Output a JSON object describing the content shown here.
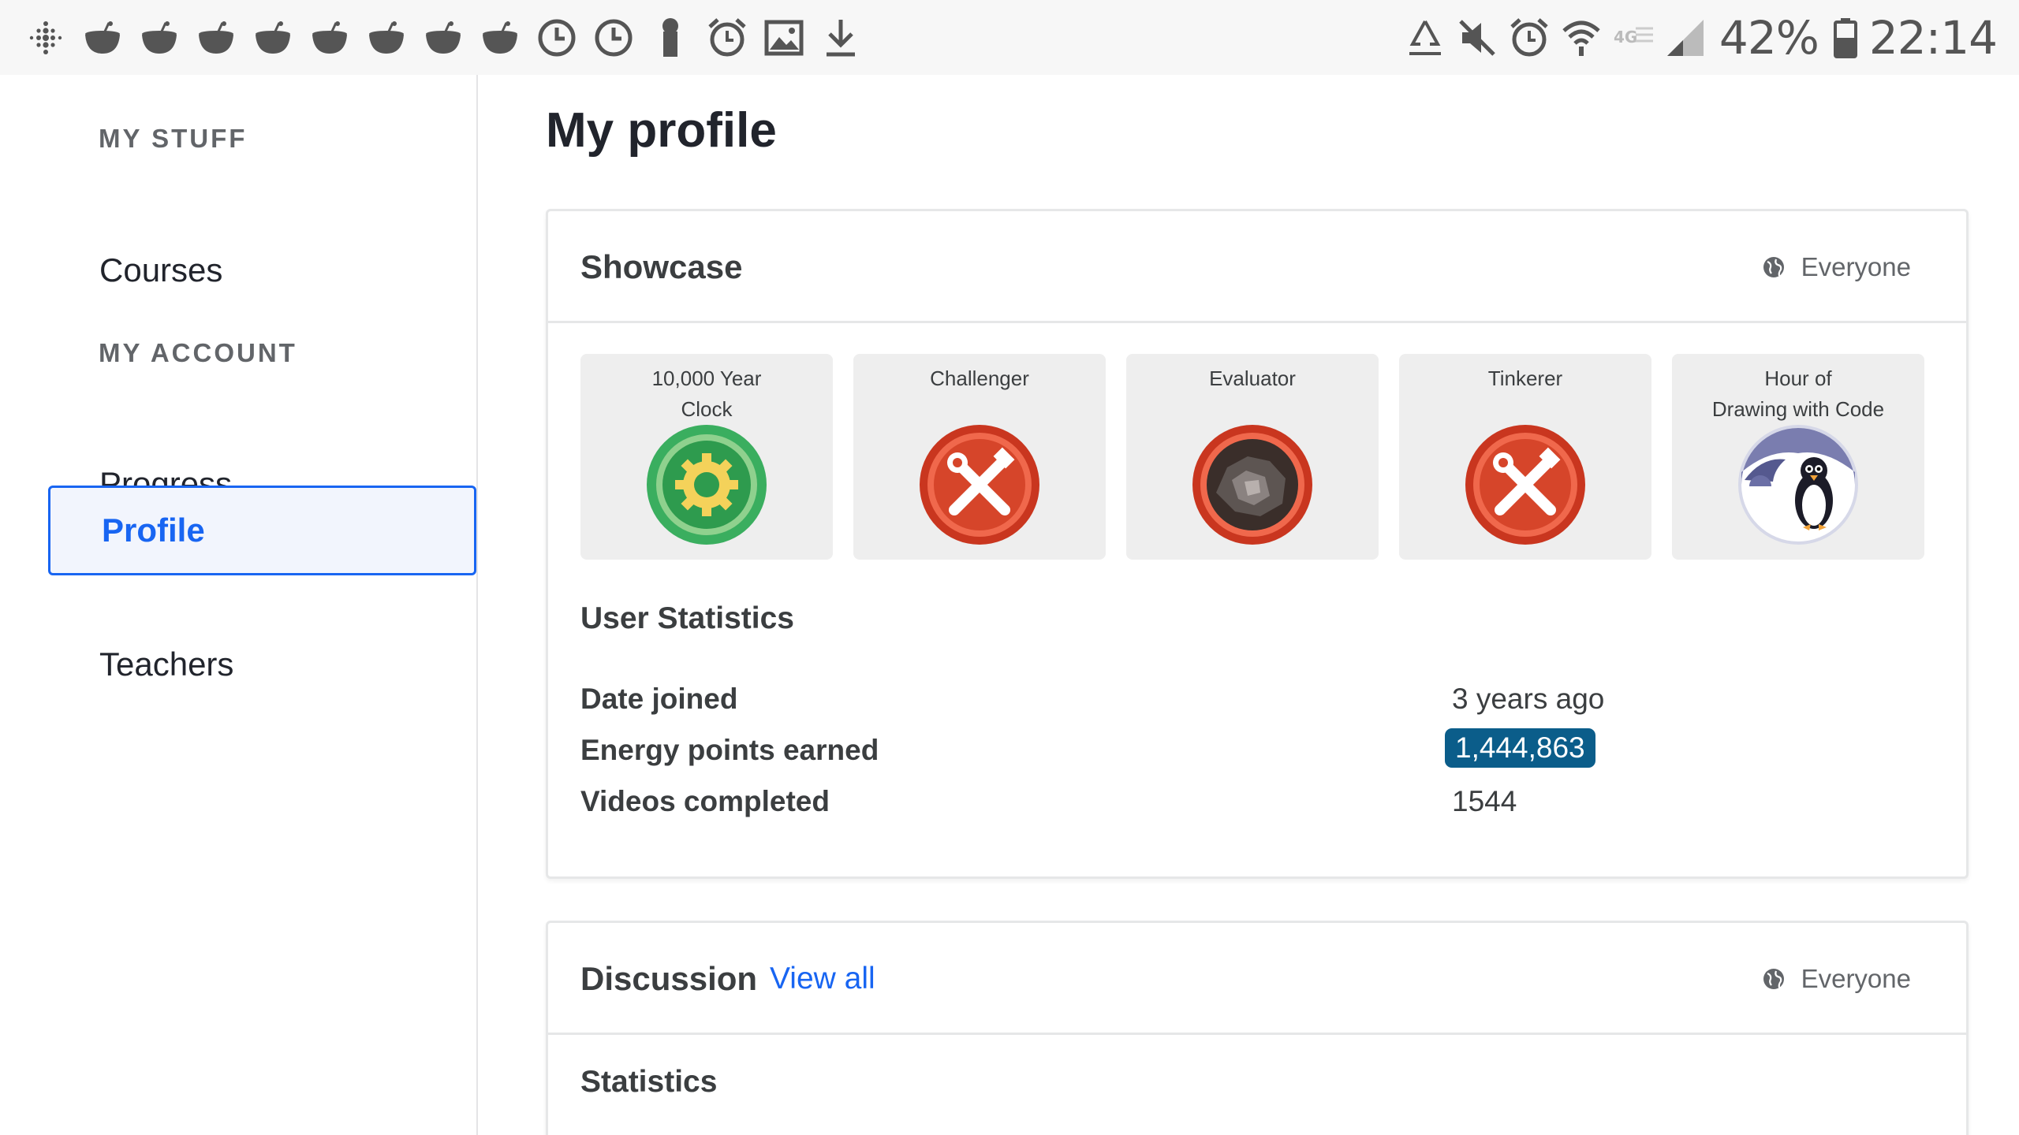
{
  "status_bar": {
    "left_icons": [
      "fitbit-icon",
      "notification-icon",
      "notification-icon",
      "notification-icon",
      "notification-icon",
      "notification-icon",
      "notification-icon",
      "notification-icon",
      "notification-icon",
      "clock-icon",
      "clock-icon",
      "key-icon",
      "alarm-icon",
      "image-icon",
      "download-icon"
    ],
    "right_icons": [
      "recycle-icon",
      "mute-icon",
      "alarm-icon",
      "wifi-icon",
      "volte-icon",
      "signal-icon"
    ],
    "battery": "42%",
    "time": "22:14"
  },
  "sidebar": {
    "section_1": "MY STUFF",
    "courses": "Courses",
    "section_2": "MY ACCOUNT",
    "progress": "Progress",
    "profile": "Profile",
    "teachers": "Teachers"
  },
  "main": {
    "title": "My profile",
    "showcase": {
      "title": "Showcase",
      "visibility": "Everyone",
      "badges": [
        {
          "name_line1": "10,000 Year",
          "name_line2": "Clock",
          "icon": "gear-badge-icon"
        },
        {
          "name_line1": "Challenger",
          "name_line2": "",
          "icon": "tools-badge-icon"
        },
        {
          "name_line1": "Evaluator",
          "name_line2": "",
          "icon": "rock-badge-icon"
        },
        {
          "name_line1": "Tinkerer",
          "name_line2": "",
          "icon": "tools-badge-icon"
        },
        {
          "name_line1": "Hour of",
          "name_line2": "Drawing with Code",
          "icon": "penguin-badge-icon"
        }
      ],
      "stats_title": "User Statistics",
      "stats": [
        {
          "label": "Date joined",
          "value": "3 years ago"
        },
        {
          "label": "Energy points earned",
          "value": "1,444,863"
        },
        {
          "label": "Videos completed",
          "value": "1544"
        }
      ]
    },
    "discussion": {
      "title": "Discussion",
      "view_all": "View all",
      "visibility": "Everyone",
      "subheading": "Statistics"
    }
  },
  "colors": {
    "accent": "#1865f2",
    "energy_highlight": "#0b5d8a",
    "badge_bg": "#eeeeee"
  }
}
